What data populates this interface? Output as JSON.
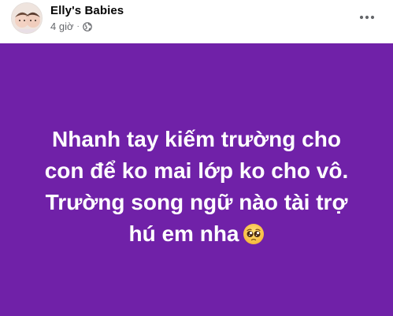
{
  "post": {
    "author_name": "Elly's Babies",
    "timestamp": "4 giờ",
    "separator": "·",
    "privacy_icon": "globe-icon",
    "more_icon": "more-horizontal-icon",
    "body_lines": [
      "Nhanh tay kiếm trường cho",
      "con để ko mai lớp ko cho vô.",
      "Trường song ngữ nào tài trợ",
      "hú em nha"
    ],
    "body_emoji": "pleading-face-icon",
    "background_color": "#7021a8",
    "text_color": "#ffffff"
  }
}
